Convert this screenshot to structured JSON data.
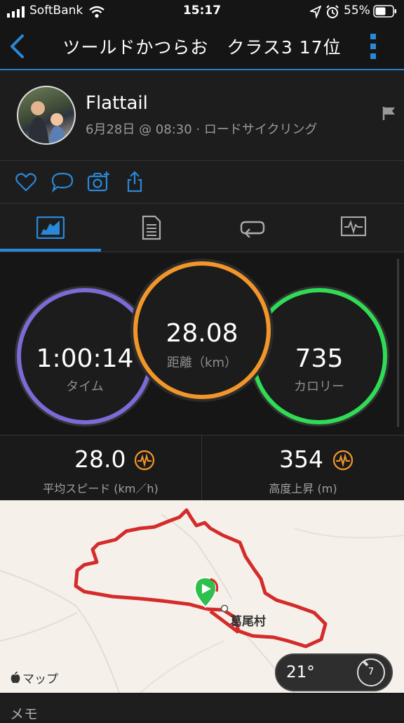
{
  "status_bar": {
    "carrier": "SoftBank",
    "time": "15:17",
    "battery": "55%"
  },
  "nav": {
    "title": "ツールドかつらお　クラス3 17位"
  },
  "profile": {
    "name": "Flattail",
    "meta": "6月28日 @ 08:30 · ロードサイクリング"
  },
  "tabs": {
    "selected_index": 0
  },
  "stats": {
    "time_value": "1:00:14",
    "time_label": "タイム",
    "distance_value": "28.08",
    "distance_label": "距離（km）",
    "calorie_value": "735",
    "calorie_label": "カロリー"
  },
  "metrics": {
    "avg_speed_value": "28.0",
    "avg_speed_label": "平均スピード (km／h)",
    "elevation_value": "354",
    "elevation_label": "高度上昇 (m)"
  },
  "map": {
    "place_label": "葛尾村",
    "attribution": "マップ",
    "route_color": "#d42b2b"
  },
  "weather": {
    "temperature": "21°",
    "wind": "7"
  },
  "memo": {
    "label": "メモ"
  },
  "colors": {
    "accent": "#2a88d8",
    "time_ring": "#7b6bd6",
    "distance_ring": "#f3962a",
    "calorie_ring": "#2fdc55",
    "metric_icon": "#f3962a"
  }
}
